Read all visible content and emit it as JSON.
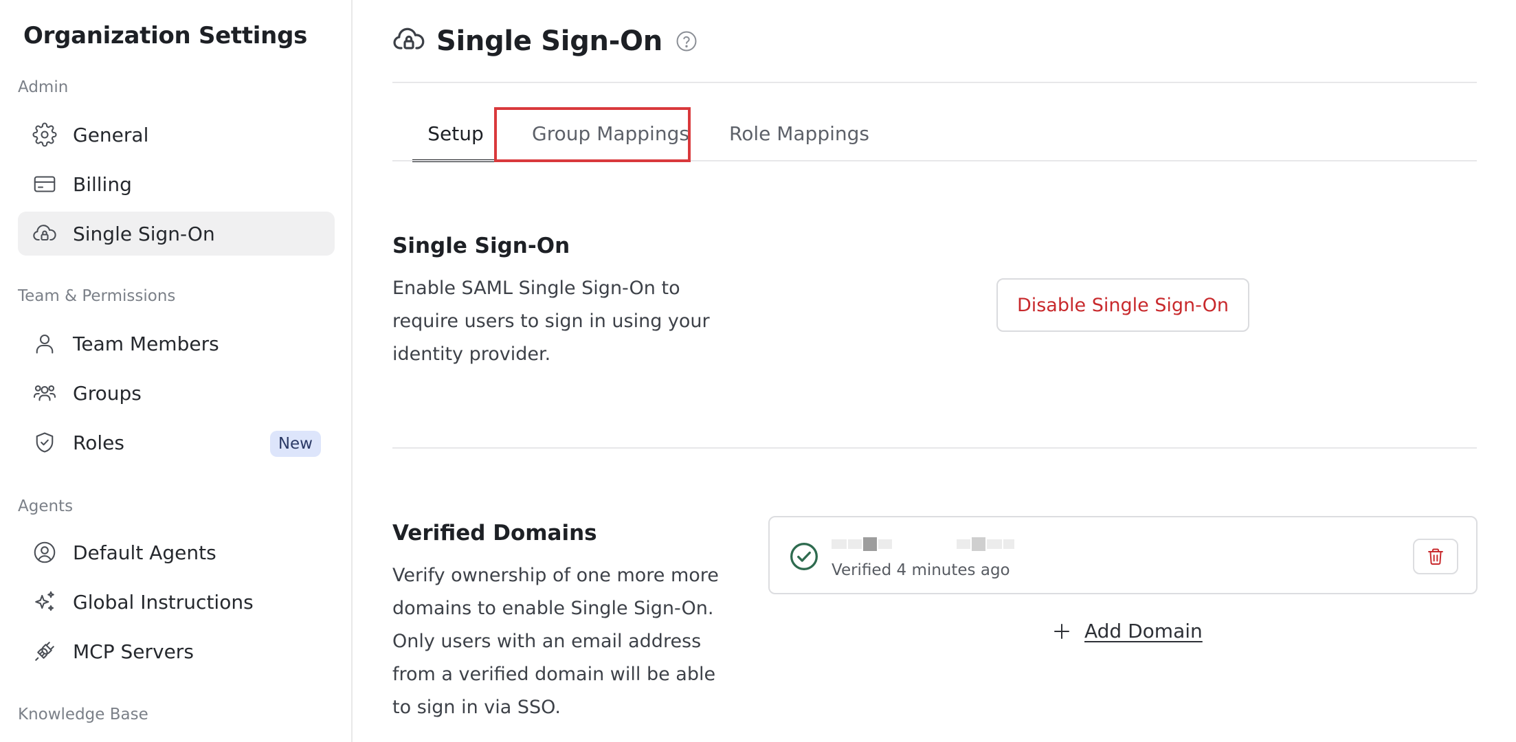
{
  "sidebar": {
    "title": "Organization Settings",
    "sections": [
      {
        "label": "Admin",
        "items": [
          {
            "label": "General",
            "icon": "gear-icon"
          },
          {
            "label": "Billing",
            "icon": "credit-card-icon"
          },
          {
            "label": "Single Sign-On",
            "icon": "cloud-lock-icon",
            "active": true
          }
        ]
      },
      {
        "label": "Team & Permissions",
        "items": [
          {
            "label": "Team Members",
            "icon": "user-icon"
          },
          {
            "label": "Groups",
            "icon": "users-group-icon"
          },
          {
            "label": "Roles",
            "icon": "shield-check-icon",
            "badge": "New"
          }
        ]
      },
      {
        "label": "Agents",
        "items": [
          {
            "label": "Default Agents",
            "icon": "user-circle-icon"
          },
          {
            "label": "Global Instructions",
            "icon": "sparkles-icon"
          },
          {
            "label": "MCP Servers",
            "icon": "plug-icon"
          }
        ]
      },
      {
        "label": "Knowledge Base",
        "items": []
      }
    ]
  },
  "header": {
    "title": "Single Sign-On",
    "icon": "cloud-lock-icon",
    "help_icon": "help-circle-icon"
  },
  "tabs": [
    {
      "label": "Setup",
      "active": true
    },
    {
      "label": "Group Mappings",
      "highlighted": true
    },
    {
      "label": "Role Mappings"
    }
  ],
  "sso": {
    "title": "Single Sign-On",
    "description": "Enable SAML Single Sign-On to require users to sign in using your identity provider.",
    "disable_button": "Disable Single Sign-On"
  },
  "domains": {
    "title": "Verified Domains",
    "description": "Verify ownership of one more more domains to enable Single Sign-On. Only users with an email address from a verified domain will be able to sign in via SSO.",
    "items": [
      {
        "status": "Verified 4 minutes ago",
        "status_icon": "check-circle-icon",
        "delete_icon": "trash-icon"
      }
    ],
    "add_label": "Add Domain",
    "add_icon": "plus-icon"
  },
  "colors": {
    "danger": "#c8292c",
    "success": "#2e6b4f",
    "highlight": "#d9393c",
    "badge_bg": "#dde5fb"
  }
}
